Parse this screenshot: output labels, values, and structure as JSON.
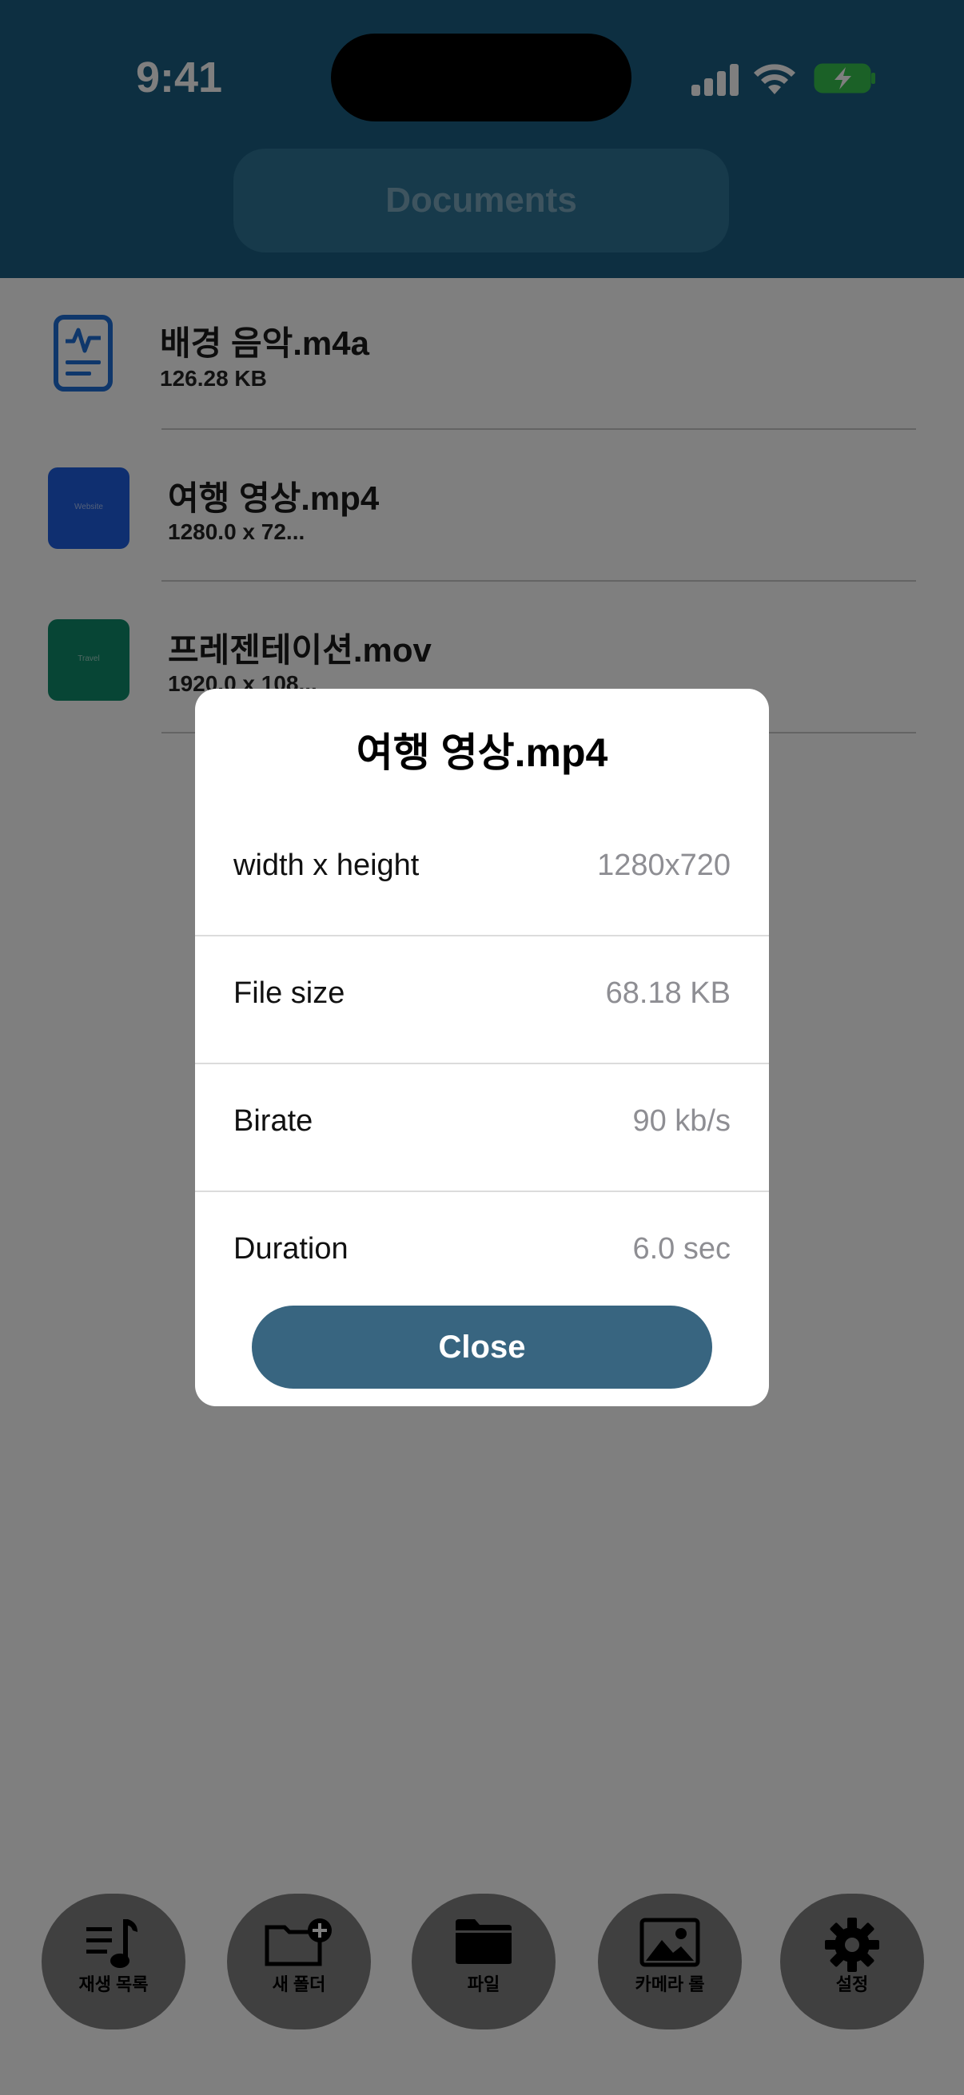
{
  "status_bar": {
    "time": "9:41"
  },
  "header": {
    "title": "Documents"
  },
  "files": [
    {
      "name": "배경 음악.m4a",
      "sub": "126.28 KB",
      "thumb_color": "#1f6fd6",
      "icon": "audio-file-icon"
    },
    {
      "name": "여행 영상.mp4",
      "sub": "1280.0 x 72...",
      "thumb_color": "#1f5fe0",
      "thumb_label": "Website",
      "icon": "video-thumbnail"
    },
    {
      "name": "프레젠테이션.mov",
      "sub": "1920.0 x 108...",
      "thumb_color": "#0f8a6a",
      "thumb_label": "Travel",
      "icon": "video-thumbnail"
    }
  ],
  "modal": {
    "title": "여행 영상.mp4",
    "rows": [
      {
        "label": "width x height",
        "value": "1280x720"
      },
      {
        "label": "File size",
        "value": "68.18 KB"
      },
      {
        "label": "Birate",
        "value": "90 kb/s"
      },
      {
        "label": "Duration",
        "value": "6.0 sec"
      }
    ],
    "close_label": "Close"
  },
  "tabs": [
    {
      "label": "재생 목록",
      "icon": "playlist-icon"
    },
    {
      "label": "새 폴더",
      "icon": "new-folder-icon"
    },
    {
      "label": "파일",
      "icon": "folder-icon"
    },
    {
      "label": "카메라 롤",
      "icon": "photo-icon"
    },
    {
      "label": "설정",
      "icon": "gear-icon"
    }
  ],
  "colors": {
    "header": "#1b5f82",
    "accent": "#386580"
  }
}
